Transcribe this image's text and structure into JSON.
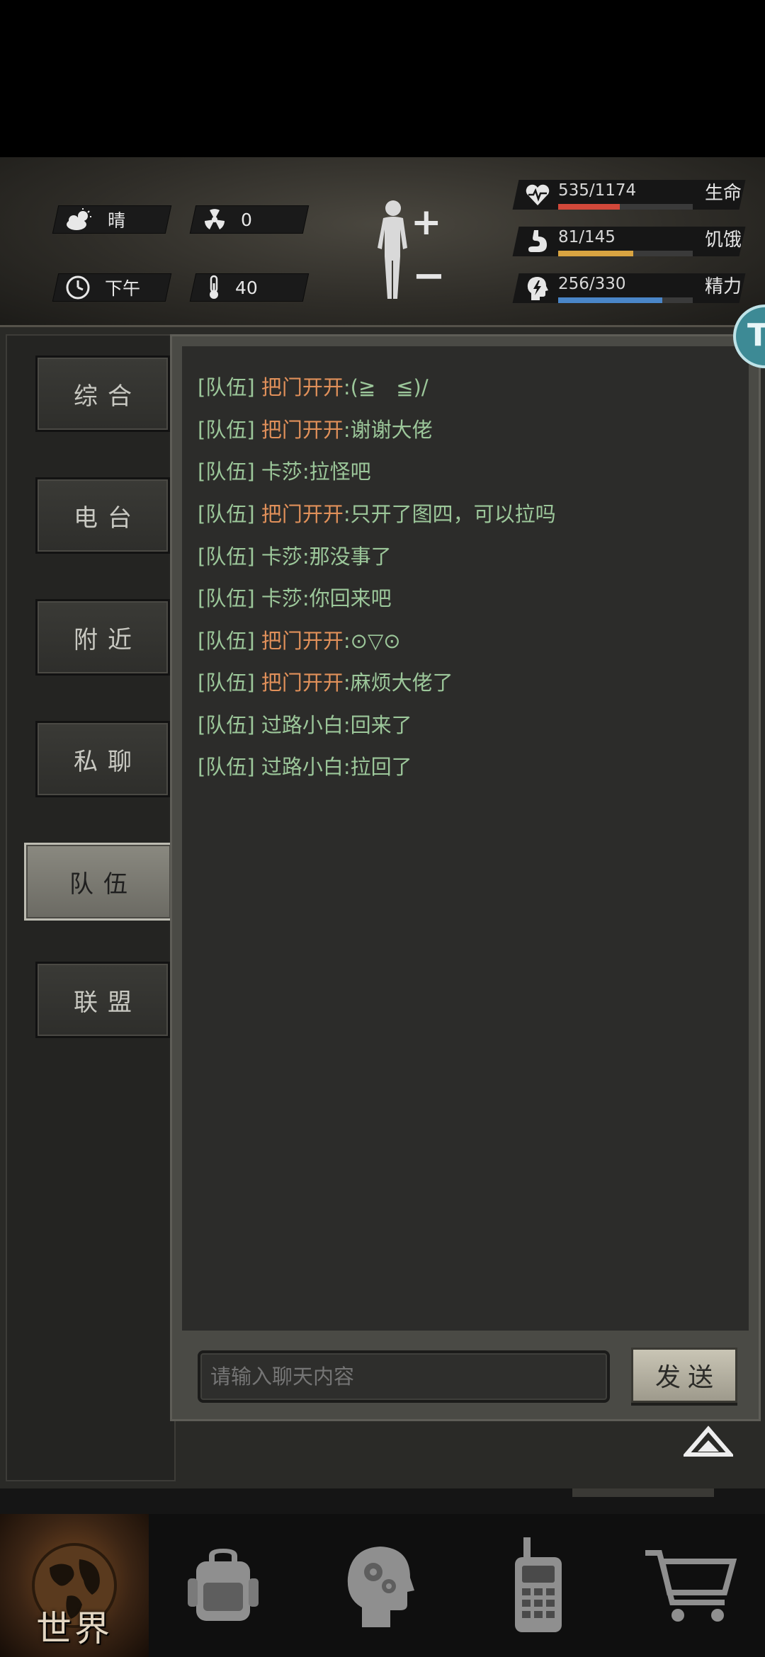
{
  "status": {
    "weather": "晴",
    "radiation": "0",
    "time_of_day": "下午",
    "temperature": "40",
    "stats": [
      {
        "label": "生命",
        "value": "535/1174",
        "fraction": 0.456,
        "color": "#d2483a",
        "icon": "heart-icon"
      },
      {
        "label": "饥饿",
        "value": "81/145",
        "fraction": 0.559,
        "color": "#d9a441",
        "icon": "stomach-icon"
      },
      {
        "label": "精力",
        "value": "256/330",
        "fraction": 0.776,
        "color": "#4a86c8",
        "icon": "energy-head-icon"
      }
    ]
  },
  "tabs": [
    {
      "label": "综合",
      "active": false
    },
    {
      "label": "电台",
      "active": false
    },
    {
      "label": "附近",
      "active": false
    },
    {
      "label": "私聊",
      "active": false
    },
    {
      "label": "队伍",
      "active": true
    },
    {
      "label": "联盟",
      "active": false
    }
  ],
  "messages": [
    {
      "tag": "[队伍]",
      "name": "把门开开",
      "text": ":(≧　≦)/",
      "name_color": "orange"
    },
    {
      "tag": "[队伍]",
      "name": "把门开开",
      "text": ":谢谢大佬",
      "name_color": "orange"
    },
    {
      "tag": "[队伍]",
      "name": "卡莎",
      "text": ":拉怪吧",
      "name_color": "green"
    },
    {
      "tag": "[队伍]",
      "name": "把门开开",
      "text": ":只开了图四，可以拉吗",
      "name_color": "orange"
    },
    {
      "tag": "[队伍]",
      "name": "卡莎",
      "text": ":那没事了",
      "name_color": "green"
    },
    {
      "tag": "[队伍]",
      "name": "卡莎",
      "text": ":你回来吧",
      "name_color": "green"
    },
    {
      "tag": "[队伍]",
      "name": "把门开开",
      "text": ":⊙▽⊙",
      "name_color": "orange"
    },
    {
      "tag": "[队伍]",
      "name": "把门开开",
      "text": ":麻烦大佬了",
      "name_color": "orange"
    },
    {
      "tag": "[队伍]",
      "name": "过路小白",
      "text": ":回来了",
      "name_color": "green"
    },
    {
      "tag": "[队伍]",
      "name": "过路小白",
      "text": ":拉回了",
      "name_color": "green"
    }
  ],
  "input": {
    "placeholder": "请输入聊天内容",
    "value": ""
  },
  "send_label": "发送",
  "bottom_nav": [
    {
      "label": "世界",
      "icon": "globe-icon",
      "active": true
    },
    {
      "label": "",
      "icon": "backpack-icon",
      "active": false
    },
    {
      "label": "",
      "icon": "head-gears-icon",
      "active": false
    },
    {
      "label": "",
      "icon": "walkie-talkie-icon",
      "active": false
    },
    {
      "label": "",
      "icon": "shopping-cart-icon",
      "active": false
    }
  ]
}
